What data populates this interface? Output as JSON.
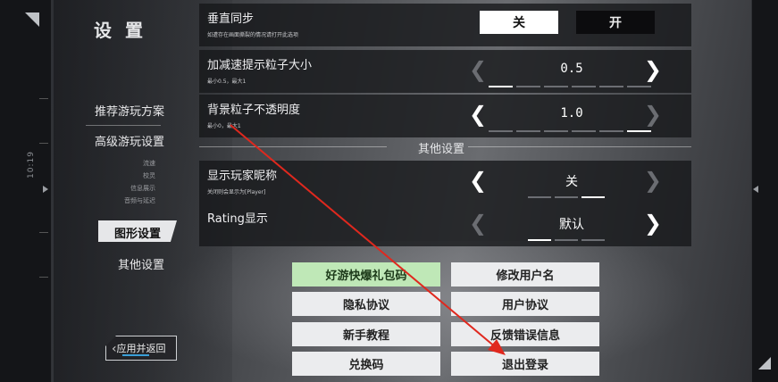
{
  "left_frame": {
    "vertical_label": "10:19"
  },
  "sidebar": {
    "title": "设 置",
    "items": [
      {
        "label": "推荐游玩方案",
        "active": false
      },
      {
        "label": "高级游玩设置",
        "active": false
      },
      {
        "label": "图形设置",
        "active": true
      },
      {
        "label": "其他设置",
        "active": false
      }
    ],
    "subitems": [
      "流速",
      "校灵",
      "信息展示",
      "音频与延迟"
    ],
    "back_button": "应用并返回"
  },
  "settings": {
    "vsync": {
      "label": "垂直同步",
      "sub": "如遭存在画面撕裂的情况请打开此选项",
      "off_label": "关",
      "on_label": "开",
      "selected": "关"
    },
    "accel_particle_size": {
      "label": "加减速提示粒子大小",
      "sub": "最小0.5，最大1",
      "value": "0.5",
      "level_index": 0,
      "levels": 6
    },
    "bg_particle_opacity": {
      "label": "背景粒子不透明度",
      "sub": "最小0，最大1",
      "value": "1.0",
      "level_index": 5,
      "levels": 6
    },
    "section_title": "其他设置",
    "show_nickname": {
      "label": "显示玩家昵称",
      "sub": "关闭则会显示为[Player]",
      "value": "关",
      "level_index": 2,
      "levels": 3
    },
    "rating_display": {
      "label": "Rating显示",
      "value": "默认",
      "level_index": 0,
      "levels": 3
    }
  },
  "buttons": [
    {
      "label": "好游快爆礼包码",
      "highlight": true
    },
    {
      "label": "修改用户名",
      "highlight": false
    },
    {
      "label": "隐私协议",
      "highlight": false
    },
    {
      "label": "用户协议",
      "highlight": false
    },
    {
      "label": "新手教程",
      "highlight": false
    },
    {
      "label": "反馈错误信息",
      "highlight": false
    },
    {
      "label": "兑换码",
      "highlight": false
    },
    {
      "label": "退出登录",
      "highlight": false
    }
  ],
  "colors": {
    "highlight_green": "#bfe8b7",
    "annotation_arrow": "#e0281e",
    "progress_blue": "#3aa0d8"
  }
}
